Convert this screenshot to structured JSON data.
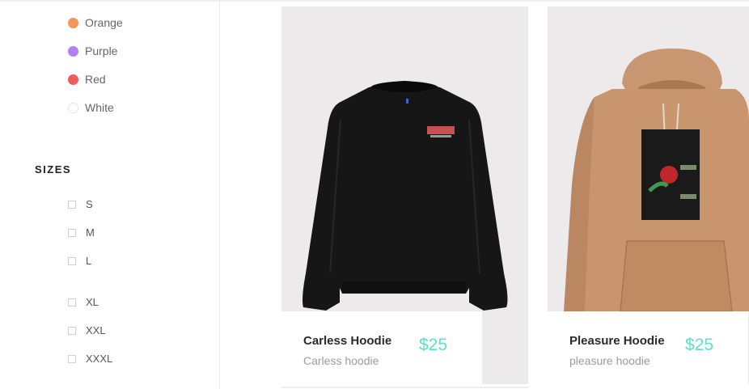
{
  "filters": {
    "colors": [
      {
        "label": "Orange",
        "swatch": "#F4965A"
      },
      {
        "label": "Purple",
        "swatch": "#B67FF5"
      },
      {
        "label": "Red",
        "swatch": "#EE5C5C"
      },
      {
        "label": "White",
        "swatch": "#FFFFFF"
      }
    ],
    "sizes_title": "SIZES",
    "sizes": [
      "S",
      "M",
      "L",
      "XL",
      "XXL",
      "XXXL"
    ]
  },
  "products": [
    {
      "name": "Carless Hoodie",
      "description": "Carless hoodie",
      "price": "$25",
      "image": "black-sweatshirt"
    },
    {
      "name": "Pleasure Hoodie",
      "description": "pleasure hoodie",
      "price": "$25",
      "image": "tan-hoodie"
    }
  ],
  "colors": {
    "price": "#5FE0C6",
    "card_bg": "#ECEAEA"
  }
}
